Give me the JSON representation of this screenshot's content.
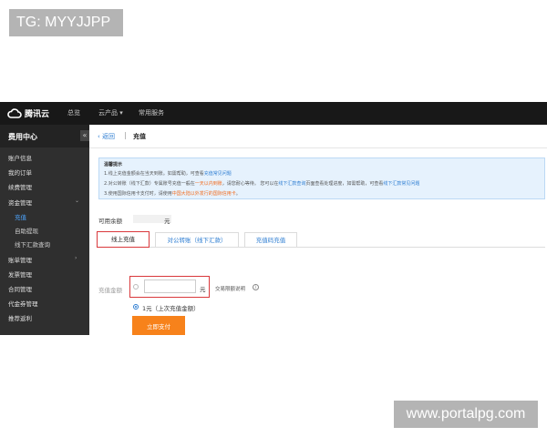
{
  "overlay": {
    "tag": "TG: MYYJJPP",
    "watermark": "www.portalpg.com"
  },
  "topbar": {
    "logo_text": "腾讯云",
    "nav": [
      "总览",
      "云产品 ▾",
      "常用服务"
    ]
  },
  "sidebar": {
    "title": "费用中心",
    "collapse": "«",
    "items": [
      {
        "label": "账户信息"
      },
      {
        "label": "我的订单"
      },
      {
        "label": "续费管理"
      },
      {
        "label": "资金管理"
      },
      {
        "label": "充值"
      },
      {
        "label": "自助提现"
      },
      {
        "label": "线下汇款查询"
      },
      {
        "label": "账单管理"
      },
      {
        "label": "发票管理"
      },
      {
        "label": "合同管理"
      },
      {
        "label": "代金券管理"
      },
      {
        "label": "推荐返利"
      }
    ]
  },
  "breadcrumb": {
    "back": "返回",
    "separator": "|",
    "title": "充值"
  },
  "notice": {
    "title": "温馨提示",
    "line1_a": "1.线上充值金额会在当天到账。如需帮助，可查看",
    "line1_link": "充值常见问题",
    "line2_a": "2.对公转账（线下汇款）专属账号充值一般在",
    "line2_hl": "一天以内到账",
    "line2_b": "，请您耐心等待。 您可以在",
    "line2_link1": "线下汇款查询",
    "line2_c": "页面查看处理进度，如需帮助，可查看",
    "line2_link2": "线下汇款常见问题",
    "line3_a": "3.使用国际信用卡支付时，请使用",
    "line3_hl": "中国大陆以外发行的国际信用卡",
    "line3_b": "。"
  },
  "balance": {
    "label": "可用余额",
    "unit": "元"
  },
  "tabs": [
    "线上充值",
    "对公转账（线下汇款）",
    "充值码充值"
  ],
  "form": {
    "amount_label": "充值金额",
    "unit": "元",
    "fee_link": "交易限额说明",
    "info": "i",
    "last_amount": "1元（上次充值金额）",
    "pay_button": "立即支付"
  },
  "colors": {
    "accent": "#2d7dd2",
    "highlight": "#d9383b",
    "pay": "#f7821b"
  }
}
